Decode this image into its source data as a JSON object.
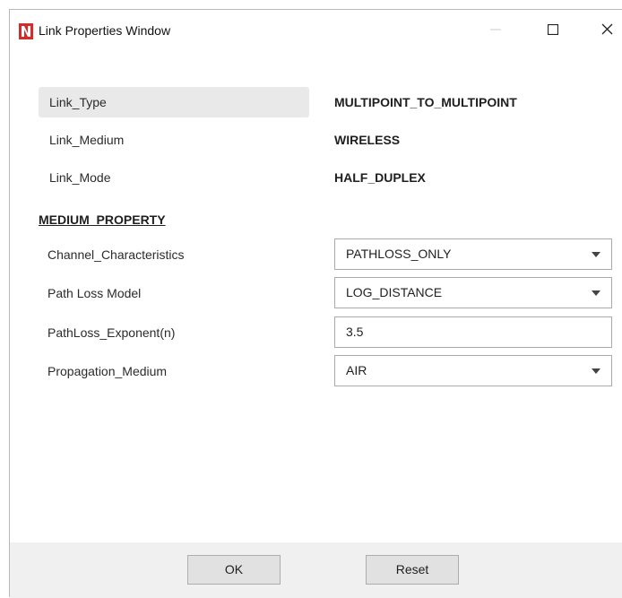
{
  "window": {
    "title": "Link Properties Window"
  },
  "properties": [
    {
      "label": "Link_Type",
      "value": "MULTIPOINT_TO_MULTIPOINT"
    },
    {
      "label": "Link_Medium",
      "value": "WIRELESS"
    },
    {
      "label": "Link_Mode",
      "value": "HALF_DUPLEX"
    }
  ],
  "medium_property": {
    "section_title": "MEDIUM_PROPERTY",
    "fields": [
      {
        "label": "Channel_Characteristics",
        "value": "PATHLOSS_ONLY",
        "kind": "dropdown"
      },
      {
        "label": "Path Loss Model",
        "value": "LOG_DISTANCE",
        "kind": "dropdown"
      },
      {
        "label": "PathLoss_Exponent(n)",
        "value": "3.5",
        "kind": "text"
      },
      {
        "label": "Propagation_Medium",
        "value": "AIR",
        "kind": "dropdown"
      }
    ]
  },
  "footer": {
    "ok_label": "OK",
    "reset_label": "Reset"
  },
  "colors": {
    "app_icon_red": "#d62b2b",
    "selected_row_bg": "#e9e9e9",
    "footer_bg": "#f0f0f0"
  },
  "icons": {
    "app": "netsim-logo-icon",
    "minimize": "minimize-icon",
    "maximize": "maximize-icon",
    "close": "close-icon"
  }
}
